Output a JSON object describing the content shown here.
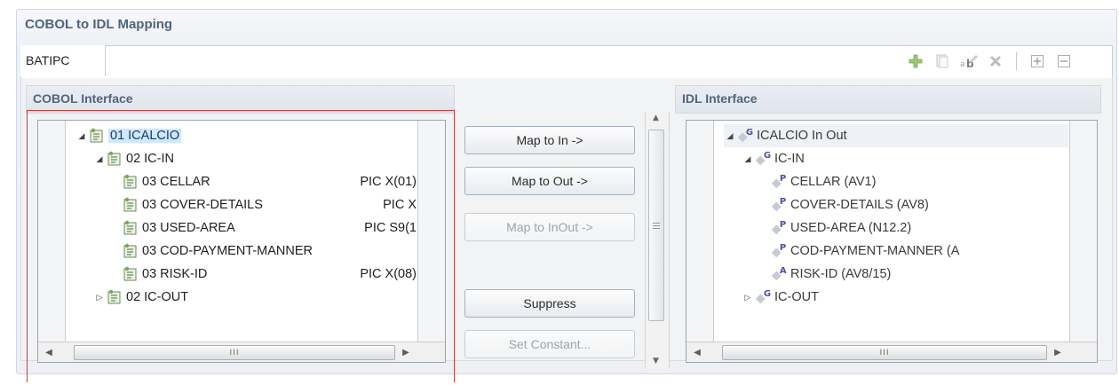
{
  "frame_title": "COBOL to IDL Mapping",
  "tab": {
    "label": "BATIPC"
  },
  "toolbar": {
    "icons": [
      "add-icon",
      "copy-icon",
      "rename-icon",
      "delete-icon",
      "expand-all-icon",
      "collapse-all-icon"
    ]
  },
  "cobol": {
    "header": "COBOL Interface",
    "rows": [
      {
        "text": "01 ICALCIO",
        "pic": ""
      },
      {
        "text": "02 IC-IN",
        "pic": ""
      },
      {
        "text": "03 CELLAR",
        "pic": "PIC  X(01)"
      },
      {
        "text": "03 COVER-DETAILS",
        "pic": "PIC  X"
      },
      {
        "text": "03 USED-AREA",
        "pic": "PIC S9(1"
      },
      {
        "text": "03 COD-PAYMENT-MANNER",
        "pic": ""
      },
      {
        "text": "03 RISK-ID",
        "pic": "PIC  X(08)"
      },
      {
        "text": "02 IC-OUT",
        "pic": ""
      }
    ]
  },
  "buttons": {
    "map_in": "Map to In ->",
    "map_out": "Map to Out ->",
    "map_inout": "Map to InOut ->",
    "suppress": "Suppress",
    "set_constant": "Set Constant..."
  },
  "idl": {
    "header": "IDL Interface",
    "rows": [
      {
        "badge": "G",
        "text": "ICALCIO  In Out"
      },
      {
        "badge": "G",
        "text": "IC-IN"
      },
      {
        "badge": "P",
        "text": "CELLAR  (AV1)"
      },
      {
        "badge": "P",
        "text": "COVER-DETAILS  (AV8)"
      },
      {
        "badge": "P",
        "text": "USED-AREA  (N12.2)"
      },
      {
        "badge": "P",
        "text": "COD-PAYMENT-MANNER  (A"
      },
      {
        "badge": "A",
        "text": "RISK-ID  (AV8/15)"
      },
      {
        "badge": "G",
        "text": "IC-OUT"
      }
    ]
  },
  "scroll_thumb_text": "III",
  "colors": {
    "selection": "#cde8ff",
    "highlight_border": "#d23a3a",
    "section_title": "#51647c"
  }
}
